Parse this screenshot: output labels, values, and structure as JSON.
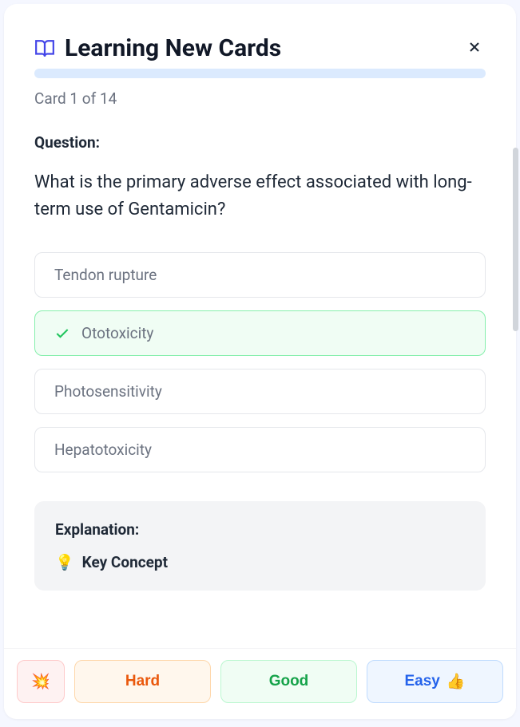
{
  "header": {
    "title": "Learning New Cards"
  },
  "progress": {
    "counter": "Card 1 of 14"
  },
  "question": {
    "label": "Question:",
    "text": "What is the primary adverse effect associated with long-term use of Gentamicin?"
  },
  "options": [
    {
      "text": "Tendon rupture",
      "correct": false
    },
    {
      "text": "Ototoxicity",
      "correct": true
    },
    {
      "text": "Photosensitivity",
      "correct": false
    },
    {
      "text": "Hepatotoxicity",
      "correct": false
    }
  ],
  "explanation": {
    "label": "Explanation:",
    "keyConceptIcon": "💡",
    "keyConceptLabel": "Key Concept"
  },
  "ratings": {
    "againIcon": "💥",
    "hard": "Hard",
    "good": "Good",
    "easy": "Easy",
    "easyIcon": "👍"
  }
}
